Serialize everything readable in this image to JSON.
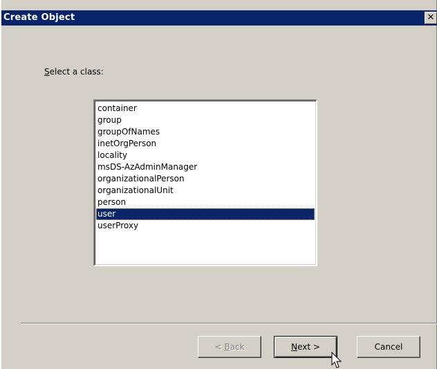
{
  "window": {
    "title": "Create Object",
    "close_glyph": "✕"
  },
  "dialog": {
    "select_label": "Select a class:",
    "classes": [
      "container",
      "group",
      "groupOfNames",
      "inetOrgPerson",
      "locality",
      "msDS-AzAdminManager",
      "organizationalPerson",
      "organizationalUnit",
      "person",
      "user",
      "userProxy"
    ],
    "selected_class": "user"
  },
  "buttons": {
    "back": "< Back",
    "next": "Next >",
    "cancel": "Cancel"
  },
  "colors": {
    "titlebar": "#0a246a",
    "selection": "#0a246a",
    "dialog_bg": "#d4d0c8"
  },
  "icons": {
    "close": "close-icon",
    "cursor": "mouse-pointer-icon"
  }
}
